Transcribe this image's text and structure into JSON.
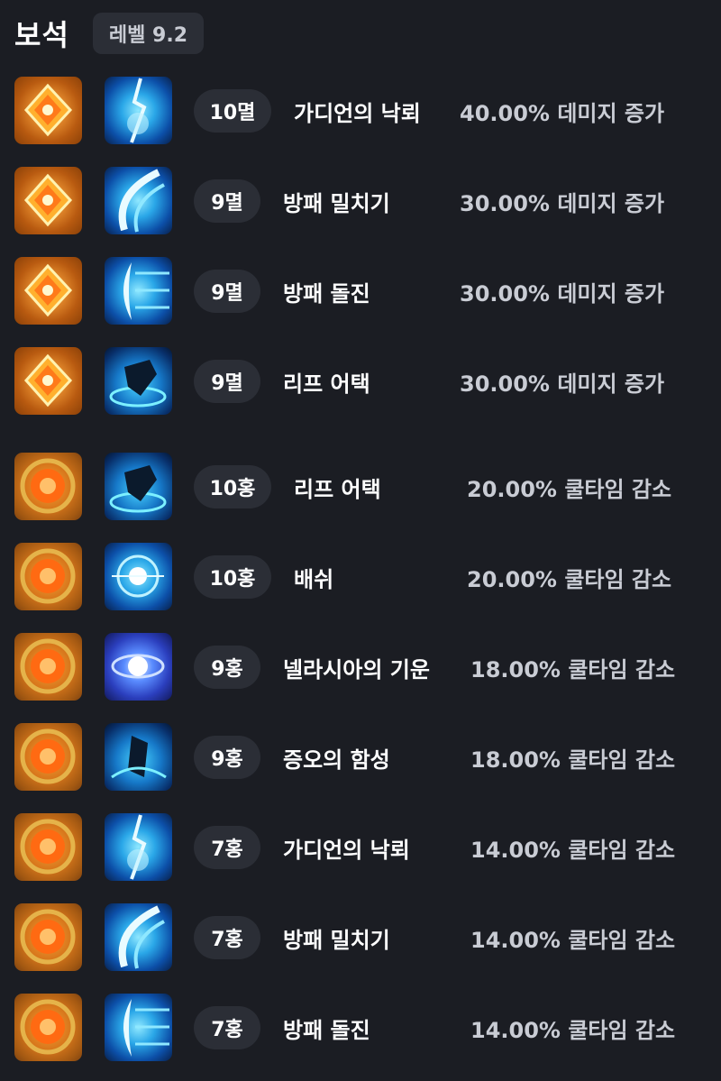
{
  "header": {
    "title": "보석",
    "level_label": "레벨 9.2"
  },
  "gems": [
    {
      "tier": "10멸",
      "skill": "가디언의 낙뢰",
      "effect": "40.00% 데미지 증가",
      "gem_icon": "myeol-gem-icon",
      "skill_icon": "lightning-skill-icon"
    },
    {
      "tier": "9멸",
      "skill": "방패 밀치기",
      "effect": "30.00% 데미지 증가",
      "gem_icon": "myeol-gem-icon",
      "skill_icon": "shield-push-skill-icon"
    },
    {
      "tier": "9멸",
      "skill": "방패 돌진",
      "effect": "30.00% 데미지 증가",
      "gem_icon": "myeol-gem-icon",
      "skill_icon": "shield-charge-skill-icon"
    },
    {
      "tier": "9멸",
      "skill": "리프 어택",
      "effect": "30.00% 데미지 증가",
      "gem_icon": "myeol-gem-icon",
      "skill_icon": "leap-attack-skill-icon"
    },
    {
      "tier": "10홍",
      "skill": "리프 어택",
      "effect": "20.00% 쿨타임 감소",
      "gem_icon": "hong-gem-icon",
      "skill_icon": "leap-attack-skill-icon"
    },
    {
      "tier": "10홍",
      "skill": "배쉬",
      "effect": "20.00% 쿨타임 감소",
      "gem_icon": "hong-gem-icon",
      "skill_icon": "bash-skill-icon"
    },
    {
      "tier": "9홍",
      "skill": "넬라시아의 기운",
      "effect": "18.00% 쿨타임 감소",
      "gem_icon": "hong-gem-icon",
      "skill_icon": "nellasia-skill-icon"
    },
    {
      "tier": "9홍",
      "skill": "증오의 함성",
      "effect": "18.00% 쿨타임 감소",
      "gem_icon": "hong-gem-icon",
      "skill_icon": "roar-skill-icon"
    },
    {
      "tier": "7홍",
      "skill": "가디언의 낙뢰",
      "effect": "14.00% 쿨타임 감소",
      "gem_icon": "hong-gem-icon",
      "skill_icon": "lightning-skill-icon"
    },
    {
      "tier": "7홍",
      "skill": "방패 밀치기",
      "effect": "14.00% 쿨타임 감소",
      "gem_icon": "hong-gem-icon",
      "skill_icon": "shield-push-skill-icon"
    },
    {
      "tier": "7홍",
      "skill": "방패 돌진",
      "effect": "14.00% 쿨타임 감소",
      "gem_icon": "hong-gem-icon",
      "skill_icon": "shield-charge-skill-icon"
    }
  ]
}
